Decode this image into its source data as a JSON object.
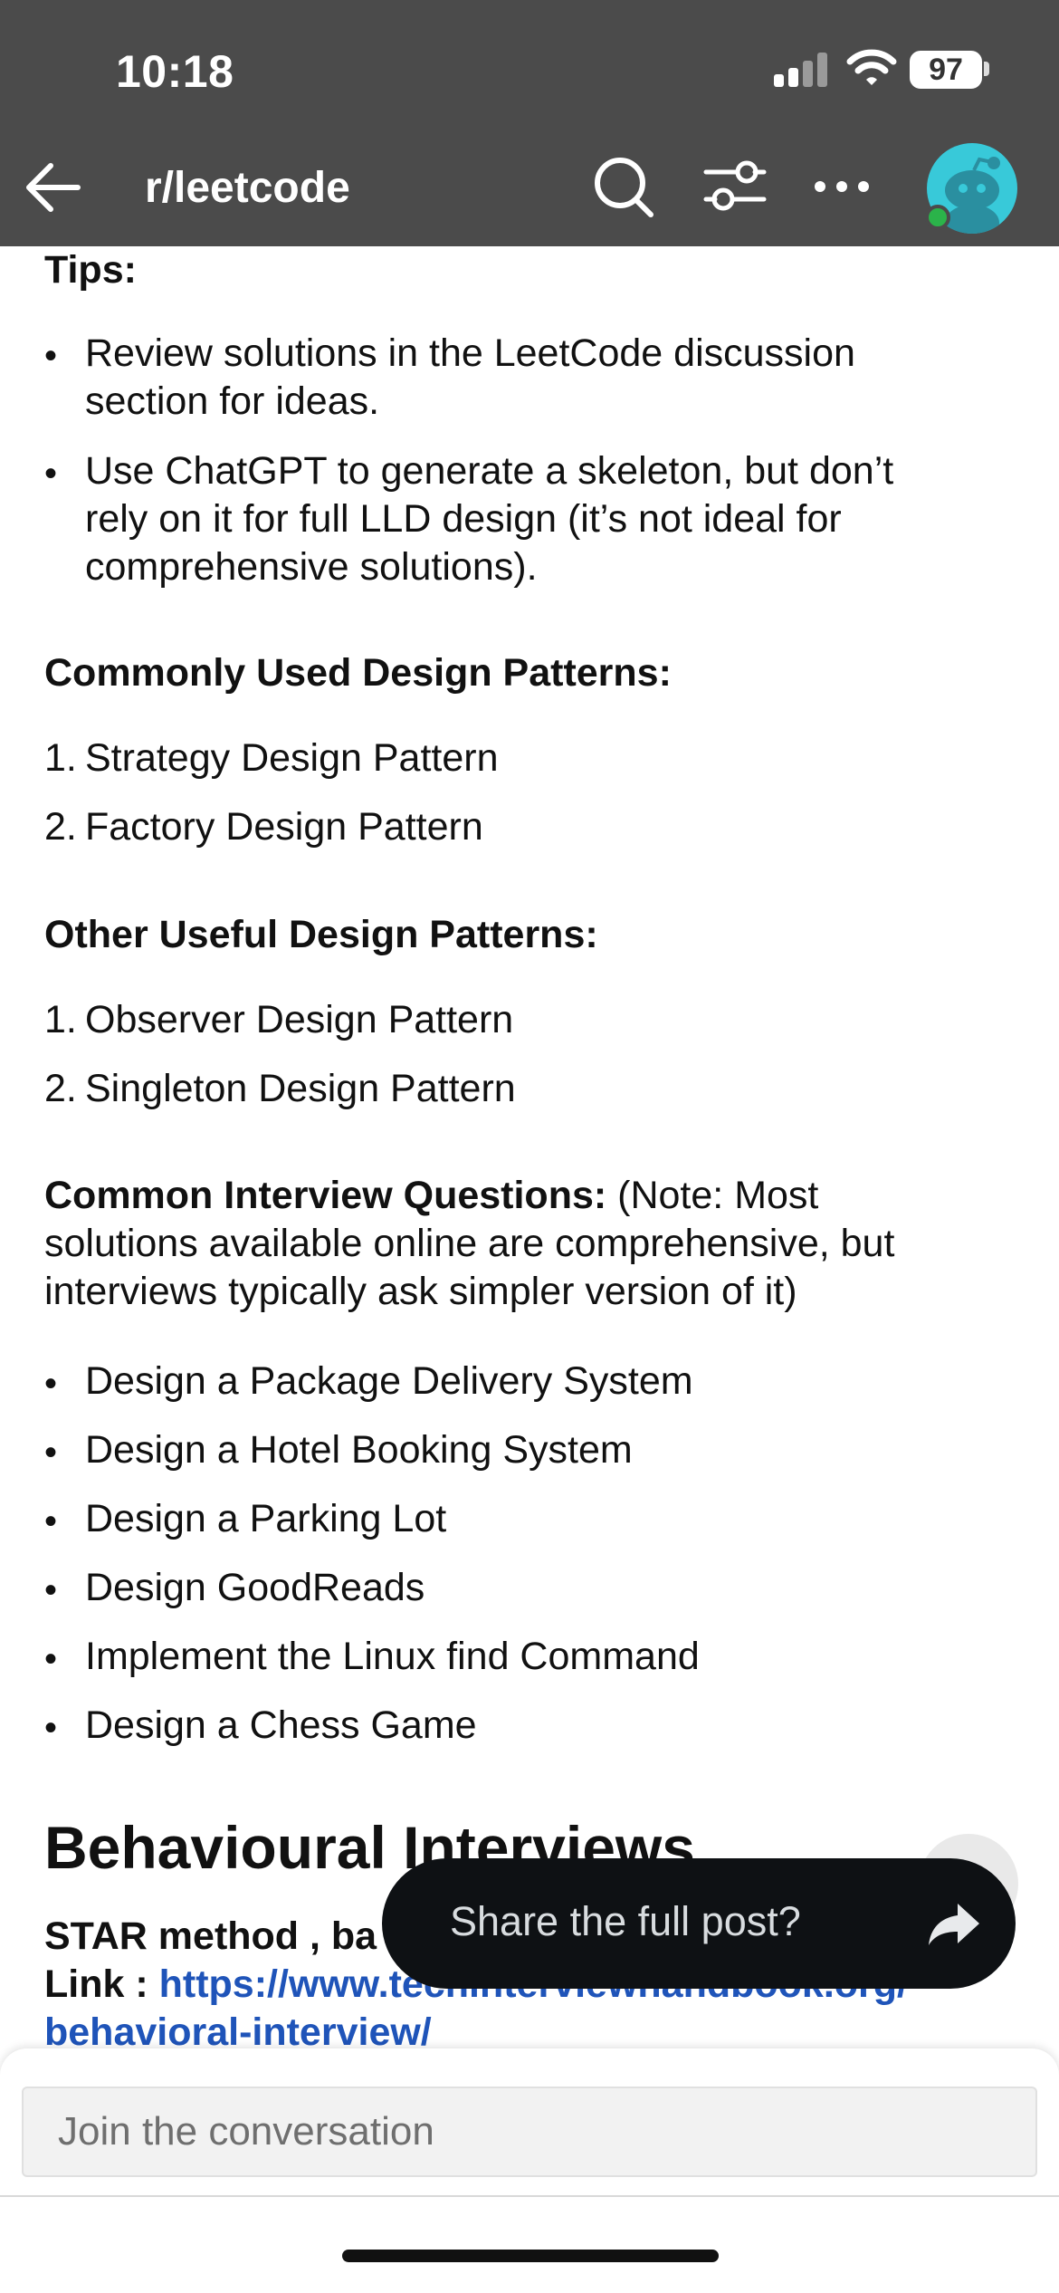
{
  "status_bar": {
    "time": "10:18",
    "battery": "97"
  },
  "nav": {
    "subreddit": "r/leetcode"
  },
  "post": {
    "tips_heading": "Tips:",
    "tips": [
      [
        "Review solutions in the LeetCode discussion",
        "section for ideas."
      ],
      [
        "Use ChatGPT to generate a skeleton, but don’t",
        "rely on it for full LLD design (it’s not ideal for",
        "comprehensive solutions)."
      ]
    ],
    "common_patterns_heading": "Commonly Used Design Patterns:",
    "common_patterns": [
      {
        "num": "1.",
        "text": "Strategy Design Pattern"
      },
      {
        "num": "2.",
        "text": "Factory Design Pattern"
      }
    ],
    "other_patterns_heading": "Other Useful Design Patterns:",
    "other_patterns": [
      {
        "num": "1.",
        "text": "Observer Design Pattern"
      },
      {
        "num": "2.",
        "text": "Singleton Design Pattern"
      }
    ],
    "questions_heading": "Common Interview Questions:",
    "questions_note_lines": [
      " (Note: Most",
      "solutions available online are comprehensive, but",
      "interviews typically ask simpler version of it)"
    ],
    "questions": [
      "Design a Package Delivery System",
      "Design a Hotel Booking System",
      "Design a Parking Lot",
      "Design GoodReads",
      "Implement the Linux find Command",
      "Design a Chess Game"
    ],
    "behavioural_heading": "Behavioural Interviews",
    "star_text": "STAR method , ba",
    "link_label": "Link : ",
    "link_line1": "https://www.techinterviewhandbook.org/",
    "link_line2": "behavioral-interview/"
  },
  "toast": {
    "text": "Share the full post?"
  },
  "composer": {
    "placeholder": "Join the conversation"
  }
}
